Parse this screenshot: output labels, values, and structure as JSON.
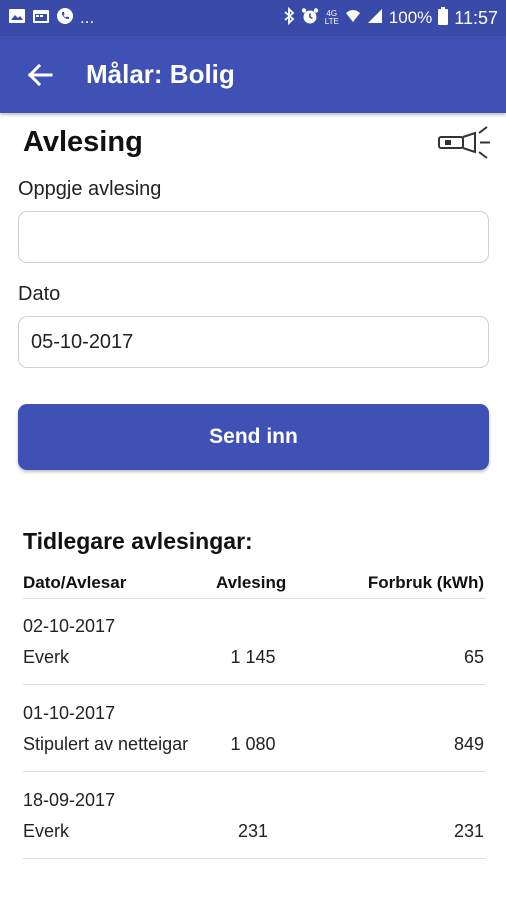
{
  "status_bar": {
    "left_icons": [
      "image-icon",
      "calendar-icon",
      "phone-icon"
    ],
    "ellipsis": "...",
    "right_icons": [
      "bluetooth-icon",
      "alarm-icon",
      "wifi-icon",
      "signal-icon",
      "battery-icon"
    ],
    "network_label_top": "4G",
    "network_label_bottom": "LTE",
    "battery_percent": "100%",
    "time": "11:57"
  },
  "app_bar": {
    "title": "Målar: Bolig",
    "back_icon": "arrow-back-icon",
    "color": "#3f51b5"
  },
  "form": {
    "section_title": "Avlesing",
    "flash_icon": "flashlight-icon",
    "reading_label": "Oppgje avlesing",
    "reading_value": "",
    "date_label": "Dato",
    "date_value": "05-10-2017",
    "submit_label": "Send inn"
  },
  "history": {
    "title": "Tidlegare avlesingar:",
    "columns": [
      "Dato/Avlesar",
      "Avlesing",
      "Forbruk (kWh)"
    ],
    "rows": [
      {
        "date": "02-10-2017",
        "reader": "Everk",
        "reading": "1 145",
        "consumption": "65"
      },
      {
        "date": "01-10-2017",
        "reader": "Stipulert av netteigar",
        "reading": "1 080",
        "consumption": "849"
      },
      {
        "date": "18-09-2017",
        "reader": "Everk",
        "reading": "231",
        "consumption": "231"
      }
    ]
  }
}
